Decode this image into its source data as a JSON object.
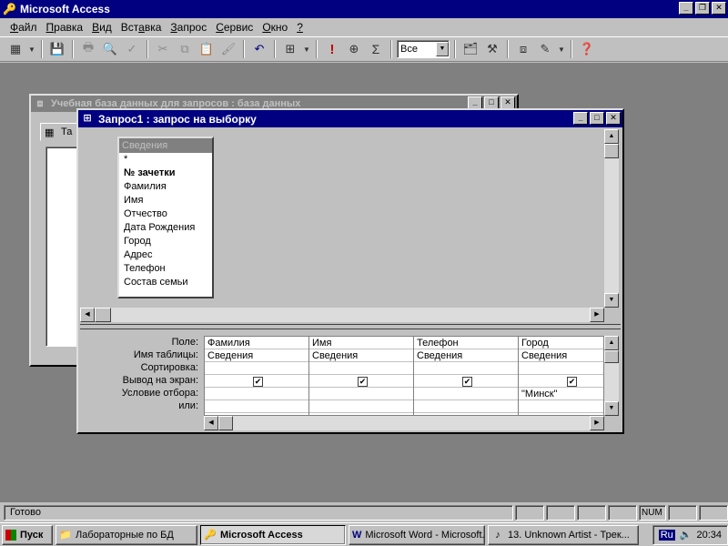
{
  "app": {
    "title": "Microsoft Access"
  },
  "menu": [
    {
      "prefix": "",
      "key": "Ф",
      "rest": "айл"
    },
    {
      "prefix": "",
      "key": "П",
      "rest": "равка"
    },
    {
      "prefix": "",
      "key": "В",
      "rest": "ид"
    },
    {
      "prefix": "Вст",
      "key": "а",
      "rest": "вка"
    },
    {
      "prefix": "",
      "key": "З",
      "rest": "апрос"
    },
    {
      "prefix": "",
      "key": "С",
      "rest": "ервис"
    },
    {
      "prefix": "",
      "key": "О",
      "rest": "кно"
    },
    {
      "prefix": "",
      "key": "?",
      "rest": ""
    }
  ],
  "toolbar": {
    "top_values": "Все"
  },
  "db_window": {
    "title": "Учебная база данных для запросов : база данных",
    "tab_label": "Та"
  },
  "query_window": {
    "title": "Запрос1 : запрос на выборку",
    "table": {
      "name": "Сведения",
      "fields": [
        "*",
        "№ зачетки",
        "Фамилия",
        "Имя",
        "Отчество",
        "Дата Рождения",
        "Город",
        "Адрес",
        "Телефон",
        "Состав семьи"
      ],
      "key_field": "№ зачетки"
    },
    "row_labels": [
      "Поле:",
      "Имя таблицы:",
      "Сортировка:",
      "Вывод на экран:",
      "Условие отбора:",
      "или:"
    ],
    "columns": [
      {
        "field": "Фамилия",
        "table": "Сведения",
        "sort": "",
        "show": true,
        "criteria": "",
        "or": ""
      },
      {
        "field": "Имя",
        "table": "Сведения",
        "sort": "",
        "show": true,
        "criteria": "",
        "or": ""
      },
      {
        "field": "Телефон",
        "table": "Сведения",
        "sort": "",
        "show": true,
        "criteria": "",
        "or": ""
      },
      {
        "field": "Город",
        "table": "Сведения",
        "sort": "",
        "show": true,
        "criteria": "\"Минск\"",
        "or": ""
      }
    ]
  },
  "statusbar": {
    "text": "Готово",
    "num": "NUM"
  },
  "taskbar": {
    "start": "Пуск",
    "buttons": [
      {
        "label": "Лабораторные по БД",
        "icon": "folder-icon",
        "active": false
      },
      {
        "label": "Microsoft Access",
        "icon": "key-icon",
        "active": true
      },
      {
        "label": "Microsoft Word - Microsoft...",
        "icon": "word-icon",
        "active": false
      },
      {
        "label": "13. Unknown Artist - Трек...",
        "icon": "music-icon",
        "active": false
      }
    ],
    "lang": "Ru",
    "clock": "20:34"
  }
}
